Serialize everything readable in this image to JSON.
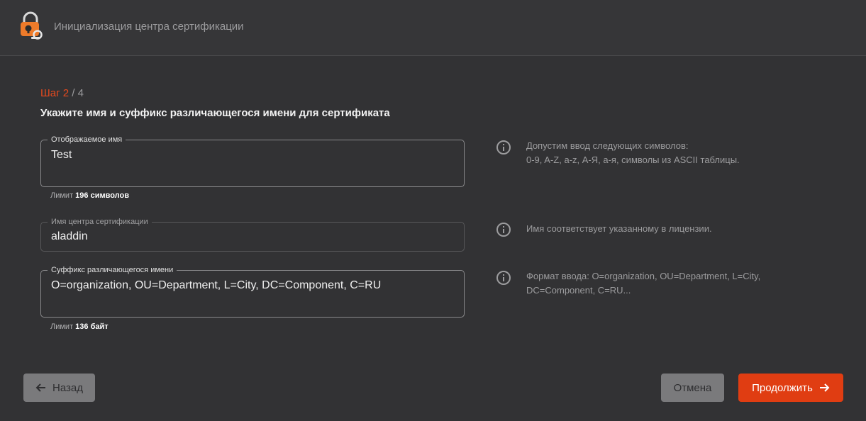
{
  "header": {
    "title": "Инициализация центра сертификации"
  },
  "step": {
    "current": "Шаг 2",
    "separator": " / ",
    "total": "4"
  },
  "heading": "Укажите имя и суффикс различающегося имени для сертификата",
  "fields": [
    {
      "label": "Отображаемое имя",
      "value": "Test",
      "limit_prefix": "Лимит",
      "limit_value": "196 символов",
      "hint": [
        "Допустим ввод следующих символов:",
        "0-9, A-Z, a-z, А-Я, а-я, символы из ASCII таблицы."
      ]
    },
    {
      "label": "Имя центра сертификации",
      "value": "aladdin",
      "disabled": true,
      "hint": [
        "Имя соответствует указанному в лицензии."
      ]
    },
    {
      "label": "Суффикс различающегося имени",
      "value": "O=organization, OU=Department, L=City, DC=Component, C=RU",
      "limit_prefix": "Лимит",
      "limit_value": "136 байт",
      "hint": [
        "Формат ввода: O=organization, OU=Department, L=City,",
        "DC=Component, C=RU..."
      ]
    }
  ],
  "buttons": {
    "back": "Назад",
    "cancel": "Отмена",
    "next": "Продолжить"
  },
  "colors": {
    "accent": "#e03d12",
    "background": "#323234",
    "header": "#363638"
  },
  "icons": {
    "logo": "padlock-key-logo-icon",
    "hint": "info-circle-icon",
    "back": "arrow-left-icon",
    "next": "arrow-right-icon"
  }
}
